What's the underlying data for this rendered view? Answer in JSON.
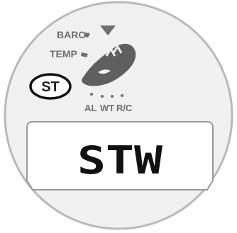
{
  "watch": {
    "modes": {
      "baro": "BARO",
      "temp": "TEMP",
      "st": "ST",
      "al": "AL",
      "wt": "WT",
      "rc": "R/C"
    },
    "highlighted_mode": "ST",
    "display": {
      "text": "STW"
    }
  },
  "colors": {
    "bezel_stroke": "#b9b9b9",
    "dial_face": "#f1f1f1",
    "crown_icon": "#5f5f5f",
    "label_gray": "#6e6e6e",
    "display_border": "#9a9a9a",
    "display_text": "#111111",
    "highlight_ring": "#111111"
  },
  "icons": {
    "crown": "crown-hand-icon",
    "pointer": "triangle-pointer-icon"
  }
}
